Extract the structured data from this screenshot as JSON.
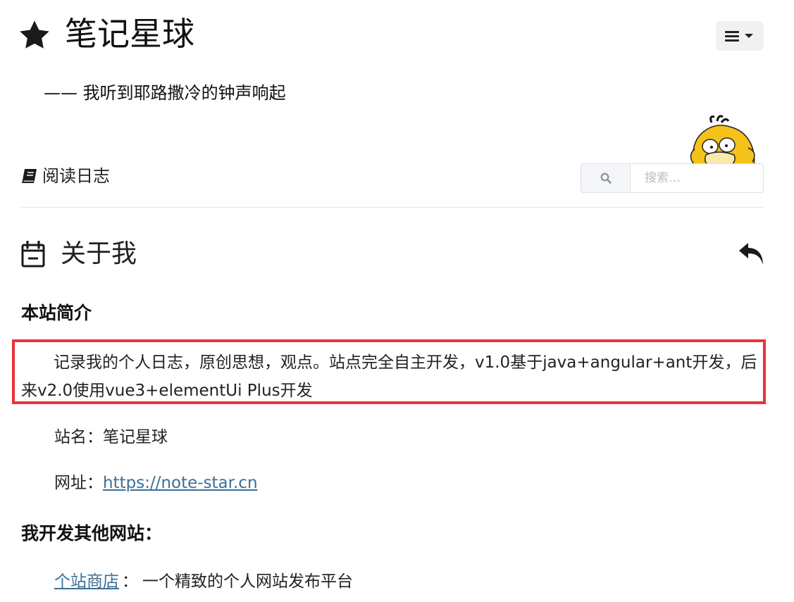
{
  "header": {
    "site_title": "笔记星球",
    "tagline": "—— 我听到耶路撒冷的钟声响起",
    "logo_icon": "star-icon",
    "menu_icon": "bars-icon"
  },
  "nav": {
    "reading_log_label": "阅读日志",
    "reading_log_icon": "book-icon"
  },
  "search": {
    "placeholder": "搜索…",
    "value": "",
    "icon": "search-icon"
  },
  "page": {
    "title": "关于我",
    "title_icon": "calendar-icon",
    "back_icon": "reply-icon"
  },
  "content": {
    "intro_heading": "本站简介",
    "intro_text": "记录我的个人日志，原创思想，观点。站点完全自主开发，v1.0基于java+angular+ant开发，后来v2.0使用vue3+elementUi Plus开发",
    "site_name_label": "站名：",
    "site_name_value": "笔记星球",
    "url_label": "网址：",
    "url_value": "https://note-star.cn",
    "other_sites_heading": "我开发其他网站：",
    "other_site_link": "个站商店",
    "other_site_sep": "：",
    "other_site_desc": "一个精致的个人网站发布平台"
  },
  "colors": {
    "highlight_border": "#e8343a",
    "link": "#3d6f96",
    "mascot_yellow": "#f5c21a"
  }
}
